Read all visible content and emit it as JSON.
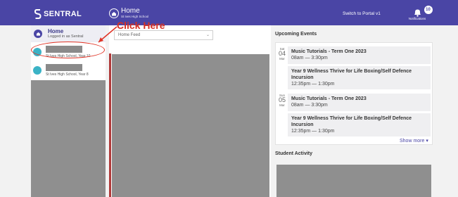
{
  "header": {
    "brand": "SENTRAL",
    "page_title": "Home",
    "page_subtitle": "St Ives High School",
    "switch_portal": "Switch to Portal v1",
    "notifications_label": "Notifications",
    "notifications_count": "10",
    "bg_color": "#4a45a5"
  },
  "sidebar": {
    "home": {
      "title": "Home",
      "subtitle": "Logged in as Sentral"
    },
    "students": [
      {
        "school": "St Ives High School, Year 10"
      },
      {
        "school": "St Ives High School, Year 8"
      }
    ]
  },
  "annotation": {
    "label": "Click Here",
    "color": "#d63024"
  },
  "feed": {
    "select_value": "Home Feed"
  },
  "events": {
    "title": "Upcoming Events",
    "dates": [
      {
        "dow": "Sat",
        "day": "04",
        "mon": "Mar"
      },
      {
        "dow": "Sun",
        "day": "05",
        "mon": "Mar"
      }
    ],
    "items": [
      {
        "title": "Music Tutorials - Term One 2023",
        "time": "08am — 3:30pm"
      },
      {
        "title": "Year 9 Wellness Thrive for Life Boxing/Self Defence Incursion",
        "time": "12:35pm — 1:30pm"
      },
      {
        "title": "Music Tutorials - Term One 2023",
        "time": "08am — 3:30pm"
      },
      {
        "title": "Year 9 Wellness Thrive for Life Boxing/Self Defence Incursion",
        "time": "12:35pm — 1:30pm"
      }
    ],
    "show_more": "Show more ▾"
  },
  "activity": {
    "title": "Student Activity"
  }
}
